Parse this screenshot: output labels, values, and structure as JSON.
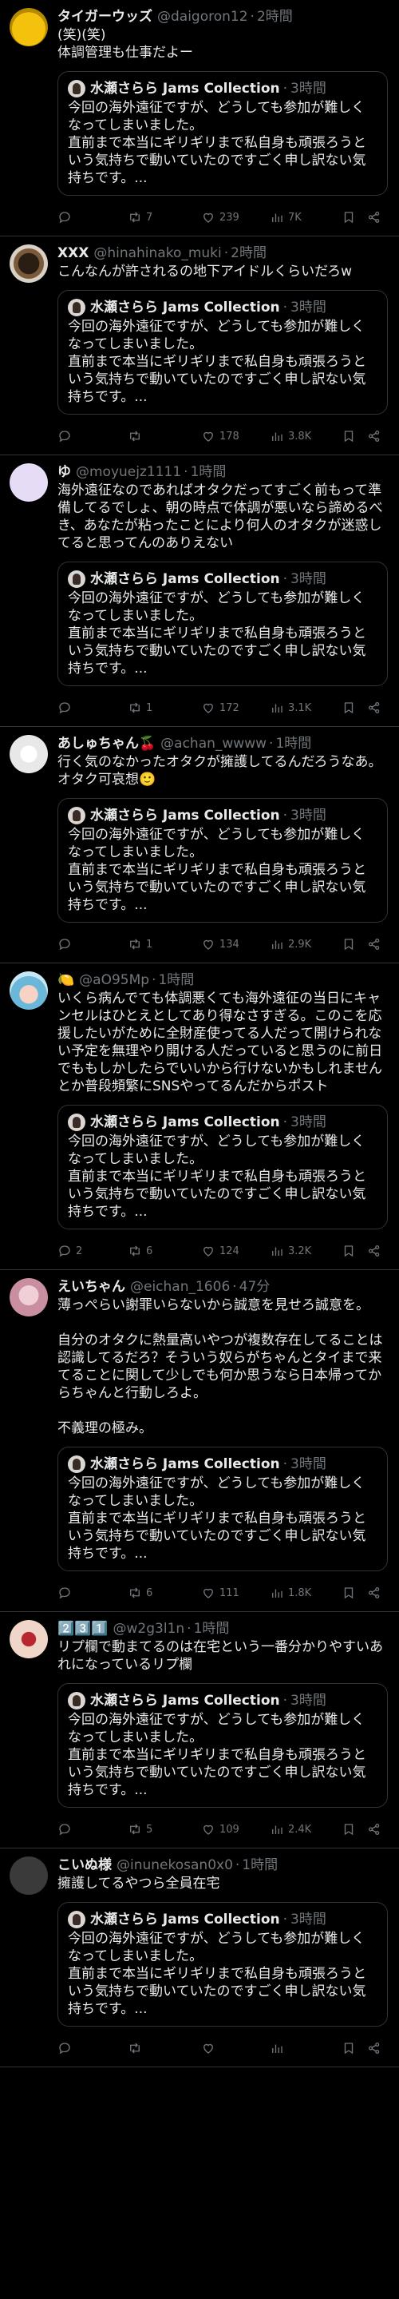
{
  "colors": {
    "background": "#000000",
    "text": "#e7e9ea",
    "muted": "#71767b",
    "border": "#2f3336"
  },
  "quote_post": {
    "author": "水瀬さらら Jams Collection",
    "time": "3時間",
    "text": "今回の海外遠征ですが、どうしても参加が難しくなってしまいました。\n直前まで本当にギリギリまで私自身も頑張ろうという気持ちで動いていたのですごく申し訳ない気持ちです。..."
  },
  "posts": [
    {
      "name": "タイガーウッズ",
      "handle": "@daigoron12",
      "time": "2時間",
      "text": "(笑)(笑)\n体調管理も仕事だよー",
      "reply": "",
      "retweet": "7",
      "like": "239",
      "views": "7K",
      "avatar_icon": "yellow-face-icon"
    },
    {
      "name": "XXX",
      "handle": "@hinahinako_muki",
      "time": "2時間",
      "text": "こんなんが許されるの地下アイドルくらいだろw",
      "reply": "",
      "retweet": "",
      "like": "178",
      "views": "3.8K",
      "avatar_icon": "dark-bowl-icon"
    },
    {
      "name": "ゆ",
      "handle": "@moyuejz1111",
      "time": "1時間",
      "text": "海外遠征なのであればオタクだってすごく前もって準備してるでしょ、朝の時点で体調が悪いなら諦めるべき、あなたが粘ったことにより何人のオタクが迷惑してると思ってんのありえない",
      "reply": "",
      "retweet": "1",
      "like": "172",
      "views": "3.1K",
      "avatar_icon": "lavender-circle-icon"
    },
    {
      "name": "あしゅちゃん🍒",
      "handle": "@achan_wwww",
      "time": "1時間",
      "text": "行く気のなかったオタクが擁護してるんだろうなあ。オタク可哀想🙂",
      "reply": "",
      "retweet": "1",
      "like": "134",
      "views": "2.9K",
      "avatar_icon": "white-flower-icon"
    },
    {
      "name": "🍋",
      "handle": "@aO95Mp",
      "time": "1時間",
      "text": "いくら病んでても体調悪くても海外遠征の当日にキャンセルはひとえとしてあり得なさすぎる。このこを応援したいがために全財産使ってる人だって開けられない予定を無理やり開ける人だっていると思うのに前日でももしかしたらでいいから行けないかもしれませんとか普段頻繁にSNSやってるんだからポスト",
      "reply": "2",
      "retweet": "6",
      "like": "124",
      "views": "3.2K",
      "avatar_icon": "anime-character-icon"
    },
    {
      "name": "えいちゃん",
      "handle": "@eichan_1606",
      "time": "47分",
      "text": "薄っぺらい謝罪いらないから誠意を見せろ誠意を。\n\n自分のオタクに熱量高いやつが複数存在してることは認識してるだろ？そういう奴らがちゃんとタイまで来てることに関して少しでも何か思うなら日本帰ってからちゃんと行動しろよ。\n\n不義理の極み。",
      "reply": "",
      "retweet": "6",
      "like": "111",
      "views": "1.8K",
      "avatar_icon": "pink-portrait-icon"
    },
    {
      "name": "2️⃣3️⃣1️⃣",
      "handle": "@w2g3l1n",
      "time": "1時間",
      "text": "リプ欄で動まてるのは在宅という一番分かりやすいあれになっているリプ欄",
      "reply": "",
      "retweet": "5",
      "like": "109",
      "views": "2.4K",
      "avatar_icon": "heart-hands-icon"
    },
    {
      "name": "こいぬ様",
      "handle": "@inunekosan0x0",
      "time": "1時間",
      "text": "擁護してるやつら全員在宅",
      "reply": "",
      "retweet": "",
      "like": "",
      "views": "",
      "avatar_icon": "gray-circle-icon"
    }
  ]
}
